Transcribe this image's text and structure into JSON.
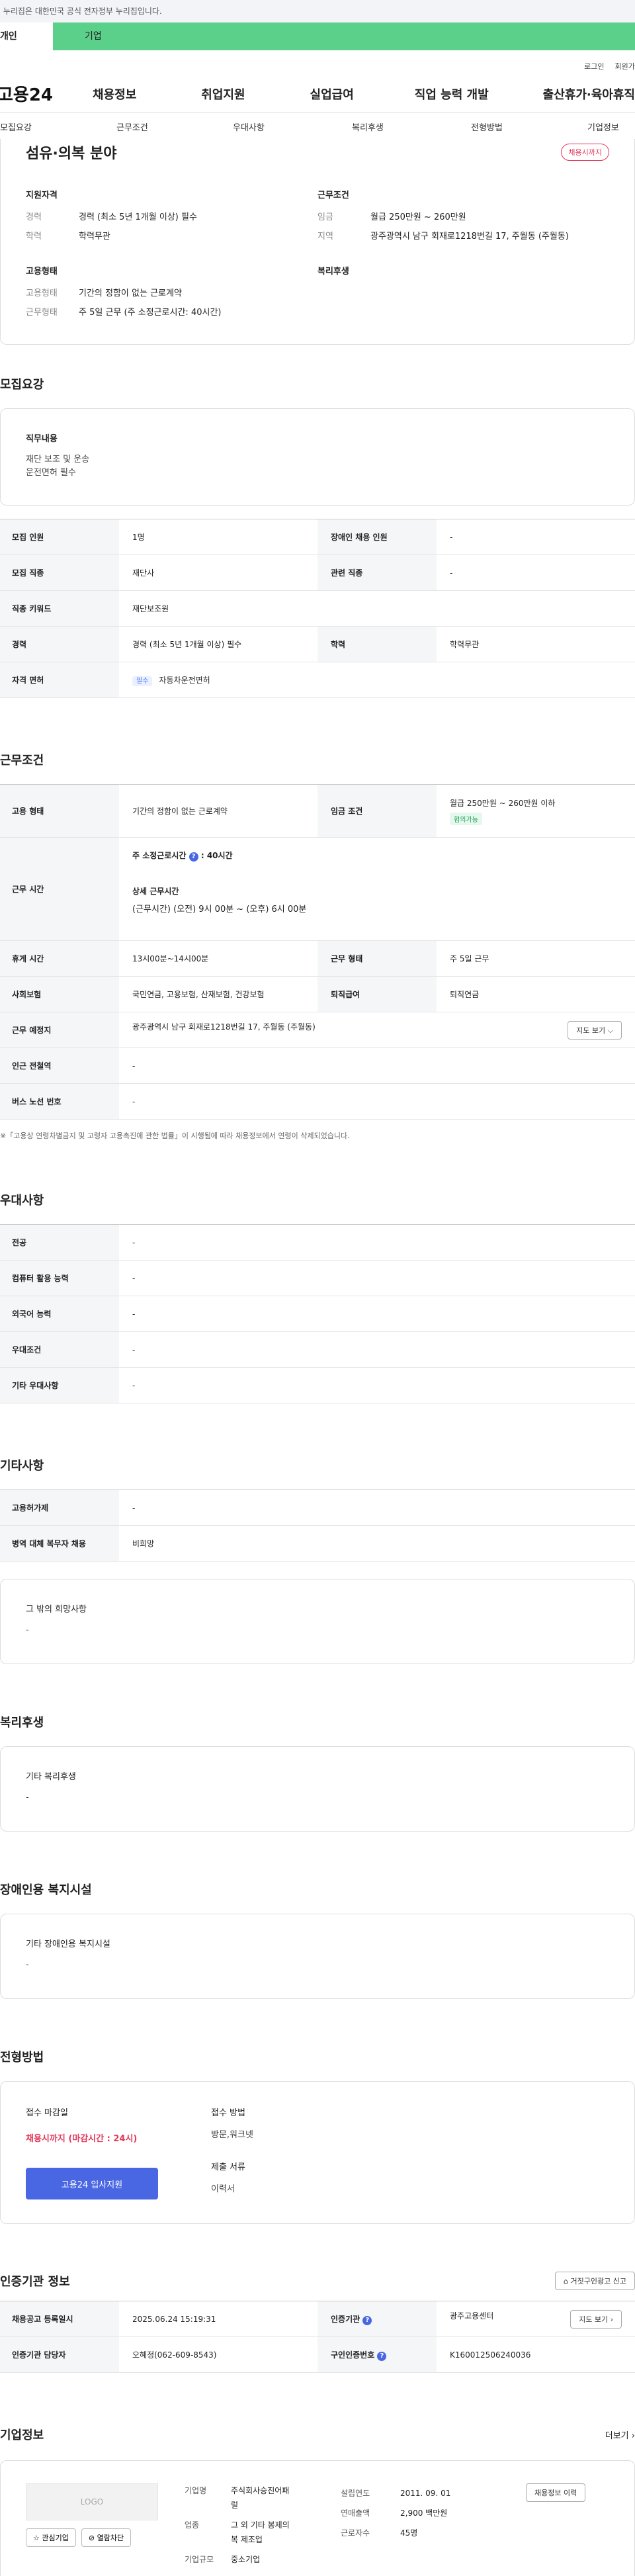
{
  "gov_banner": "이 누리집은 대한민국 공식 전자정부 누리집입니다.",
  "topbar": {
    "personal": "개인",
    "company": "기업"
  },
  "util": {
    "login": "로그인",
    "join": "회원가입"
  },
  "gnb": {
    "logo": "고용24",
    "menus": [
      "채용정보",
      "취업지원",
      "실업급여",
      "직업 능력 개발",
      "출산휴가·육아휴직"
    ]
  },
  "subnav": [
    "모집요강",
    "근무조건",
    "우대사항",
    "복리후생",
    "전형방법",
    "기업정보"
  ],
  "summary": {
    "title": "섬유·의복 분야",
    "status_badge": "채용시까지",
    "qualification_title": "지원자격",
    "career_k": "경력",
    "career_v": "경력 (최소 5년 1개월 이상) 필수",
    "edu_k": "학력",
    "edu_v": "학력무관",
    "conditions_title": "근무조건",
    "wage_k": "임금",
    "wage_v": "월급 250만원 ~ 260만원",
    "region_k": "지역",
    "region_v": "광주광역시 남구 회재로1218번길 17, 주월동 (주월동)",
    "employment_title": "고용형태",
    "emp_type_k": "고용형태",
    "emp_type_v": "기간의 정함이 없는 근로계약",
    "work_type_k": "근무형태",
    "work_type_v": "주 5일 근무 (주 소정근로시간: 40시간)",
    "welfare_title": "복리후생"
  },
  "recruit": {
    "section_title": "모집요강",
    "duty_title": "직무내용",
    "duty_lines": [
      "재단 보조 및 운송",
      "운전면허 필수"
    ],
    "rows": {
      "people_k": "모집 인원",
      "people_v": "1명",
      "disabled_k": "장애인 채용 인원",
      "disabled_v": "-",
      "job_k": "모집 직종",
      "job_v": "재단사",
      "related_k": "관련 직종",
      "related_v": "-",
      "keyword_k": "직종 키워드",
      "keyword_v": "재단보조원",
      "career_k": "경력",
      "career_v": "경력 (최소 5년 1개월 이상) 필수",
      "edu_k": "학력",
      "edu_v": "학력무관",
      "license_k": "자격 면허",
      "license_tag": "필수",
      "license_v": "자동차운전면허"
    }
  },
  "conditions": {
    "section_title": "근무조건",
    "emp_k": "고용 형태",
    "emp_v": "기간의 정함이 없는 근로계약",
    "wage_k": "임금 조건",
    "wage_v": "월급 250만원 ~ 260만원 이하",
    "wage_tag": "협의가능",
    "hours_k": "근무 시간",
    "hours_weekly_label": "주 소정근로시간",
    "hours_weekly_v": ": 40시간",
    "hours_detail_label": "상세 근무시간",
    "hours_detail_v": "(근무시간) (오전) 9시 00분 ~ (오후) 6시 00분",
    "break_k": "휴게 시간",
    "break_v": "13시00분~14시00분",
    "worktype_k": "근무 형태",
    "worktype_v": "주 5일 근무",
    "insurance_k": "사회보험",
    "insurance_v": "국민연금, 고용보험, 산재보험, 건강보험",
    "retire_k": "퇴직급여",
    "retire_v": "퇴직연금",
    "place_k": "근무 예정지",
    "place_v": "광주광역시 남구 회재로1218번길 17, 주월동 (주월동)",
    "map_btn": "지도 보기",
    "subway_k": "인근 전철역",
    "subway_v": "-",
    "bus_k": "버스 노선 번호",
    "bus_v": "-",
    "note": "※「고용상 연령차별금지 및 고령자 고용촉진에 관한 법률」이 시행됨에 따라 채용정보에서 연령이 삭제되었습니다."
  },
  "preference": {
    "section_title": "우대사항",
    "rows": [
      [
        "전공",
        "-"
      ],
      [
        "컴퓨터 활용 능력",
        "-"
      ],
      [
        "외국어 능력",
        "-"
      ],
      [
        "우대조건",
        "-"
      ],
      [
        "기타 우대사항",
        "-"
      ]
    ]
  },
  "etc": {
    "section_title": "기타사항",
    "rows": [
      [
        "고용허가제",
        "-"
      ],
      [
        "병역 대체 복무자 채용",
        "비희망"
      ]
    ],
    "other_title": "그 밖의 희망사항",
    "other_v": "-"
  },
  "welfare": {
    "section_title": "복리후생",
    "box_title": "기타 복리후생",
    "box_v": "-"
  },
  "disabled": {
    "section_title": "장애인용 복지시설",
    "box_title": "기타 장애인용 복지시설",
    "box_v": "-"
  },
  "process": {
    "section_title": "전형방법",
    "deadline_title": "접수 마감일",
    "deadline_v": "채용시까지 (마감시간 : 24시)",
    "apply_btn": "고용24 입사지원",
    "method_title": "접수 방법",
    "method_v": "방문,워크넷",
    "docs_title": "제출 서류",
    "docs_v": "이력서"
  },
  "certify": {
    "section_title": "인증기관 정보",
    "report_btn": "거짓구인광고 신고",
    "reg_k": "채용공고 등록일시",
    "reg_v": "2025.06.24 15:19:31",
    "agency_k": "인증기관",
    "agency_v": "광주고용센터",
    "map_btn": "지도 보기",
    "manager_k": "인증기관 담당자",
    "manager_v": "오혜정(062-609-8543)",
    "num_k": "구인인증번호",
    "num_v": "K160012506240036"
  },
  "company": {
    "section_title": "기업정보",
    "more": "더보기",
    "logo_text": "LOGO",
    "interest_btn": "관심기업",
    "block_btn": "열람차단",
    "name_k": "기업명",
    "name_v1": "주식회사승진어패",
    "name_v2": "럴",
    "industry_k": "업종",
    "industry_v1": "그 외 기타 봉제의",
    "industry_v2": "복 제조업",
    "size_k": "기업규모",
    "size_v": "중소기업",
    "founded_k": "설립연도",
    "founded_v": "2011. 09. 01",
    "sales_k": "연매출액",
    "sales_v": "2,900 백만원",
    "staff_k": "근로자수",
    "staff_v": "45명",
    "history_btn": "채용정보 이력"
  }
}
